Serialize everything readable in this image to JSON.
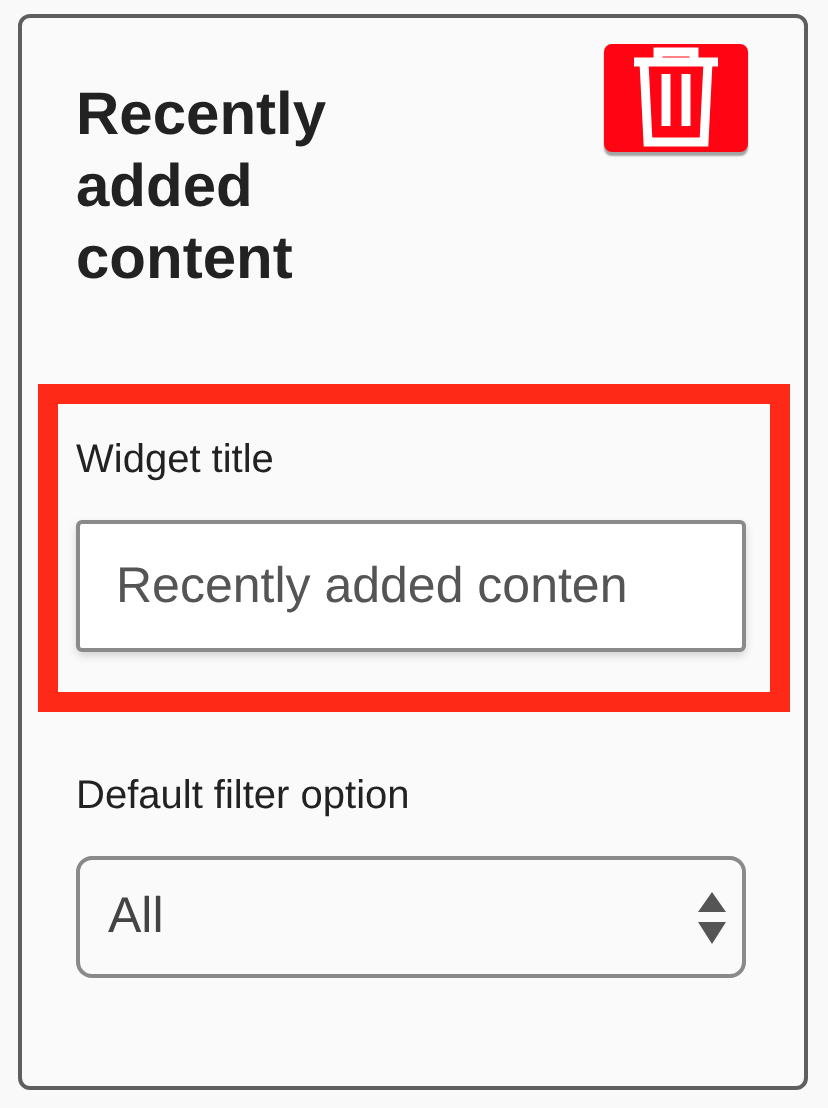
{
  "widget": {
    "title": "Recently added content"
  },
  "fields": [
    {
      "kind": "text",
      "label": "Widget title",
      "value": "Recently added conten",
      "highlighted": true
    },
    {
      "kind": "select",
      "label": "Default filter option",
      "value": "All",
      "highlighted": false
    }
  ]
}
